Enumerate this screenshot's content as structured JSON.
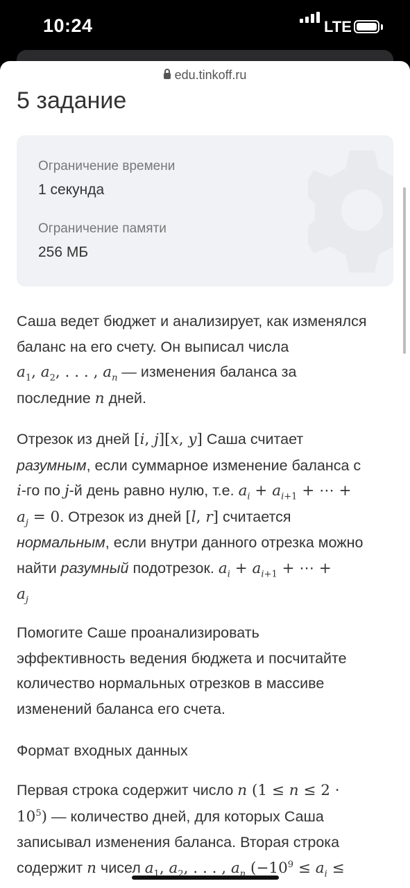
{
  "status_bar": {
    "time": "10:24",
    "network": "LTE"
  },
  "browser": {
    "url": "edu.tinkoff.ru"
  },
  "task": {
    "title": "5 задание",
    "time_limit_label": "Ограничение времени",
    "time_limit_value": "1 секунда",
    "memory_limit_label": "Ограничение памяти",
    "memory_limit_value": "256 МБ"
  },
  "statement": {
    "p1_l1": "Саша ведет бюджет и анализирует, как изменялся",
    "p1_l2": "баланс на его счету. Он выписал числа",
    "p1_l3": " — изменения баланса за",
    "p1_l4_a": "последние ",
    "p1_l4_b": " дней.",
    "p2_l1_a": "Отрезок из дней ",
    "p2_l1_b": " Саша считает",
    "p2_l2_em": "разумным",
    "p2_l2": ", если суммарное изменение баланса с",
    "p2_l3_a": "-го по ",
    "p2_l3_b": "-й день равно нулю, т.е. ",
    "p2_l4_a": ". Отрезок из дней ",
    "p2_l4_b": " считается",
    "p2_l5_em": "нормальным",
    "p2_l5": ", если внутри данного отрезка можно",
    "p2_l6_a": "найти ",
    "p2_l6_em": "разумный",
    "p2_l6_b": " подотрезок. ",
    "p3_l1": "Помогите Саше проанализировать",
    "p3_l2": "эффективность ведения бюджета и посчитайте",
    "p3_l3": "количество нормальных отрезков в массиве",
    "p3_l4": "изменений баланса его счета.",
    "input_heading": "Формат входных данных",
    "p4_l1": "Первая строка содержит число ",
    "p4_l2": " — количество дней, для которых Саша",
    "p4_l3": "записывал изменения баланса. Вторая строка",
    "p4_l4_a": "содержит ",
    "p4_l4_b": " чисел "
  }
}
